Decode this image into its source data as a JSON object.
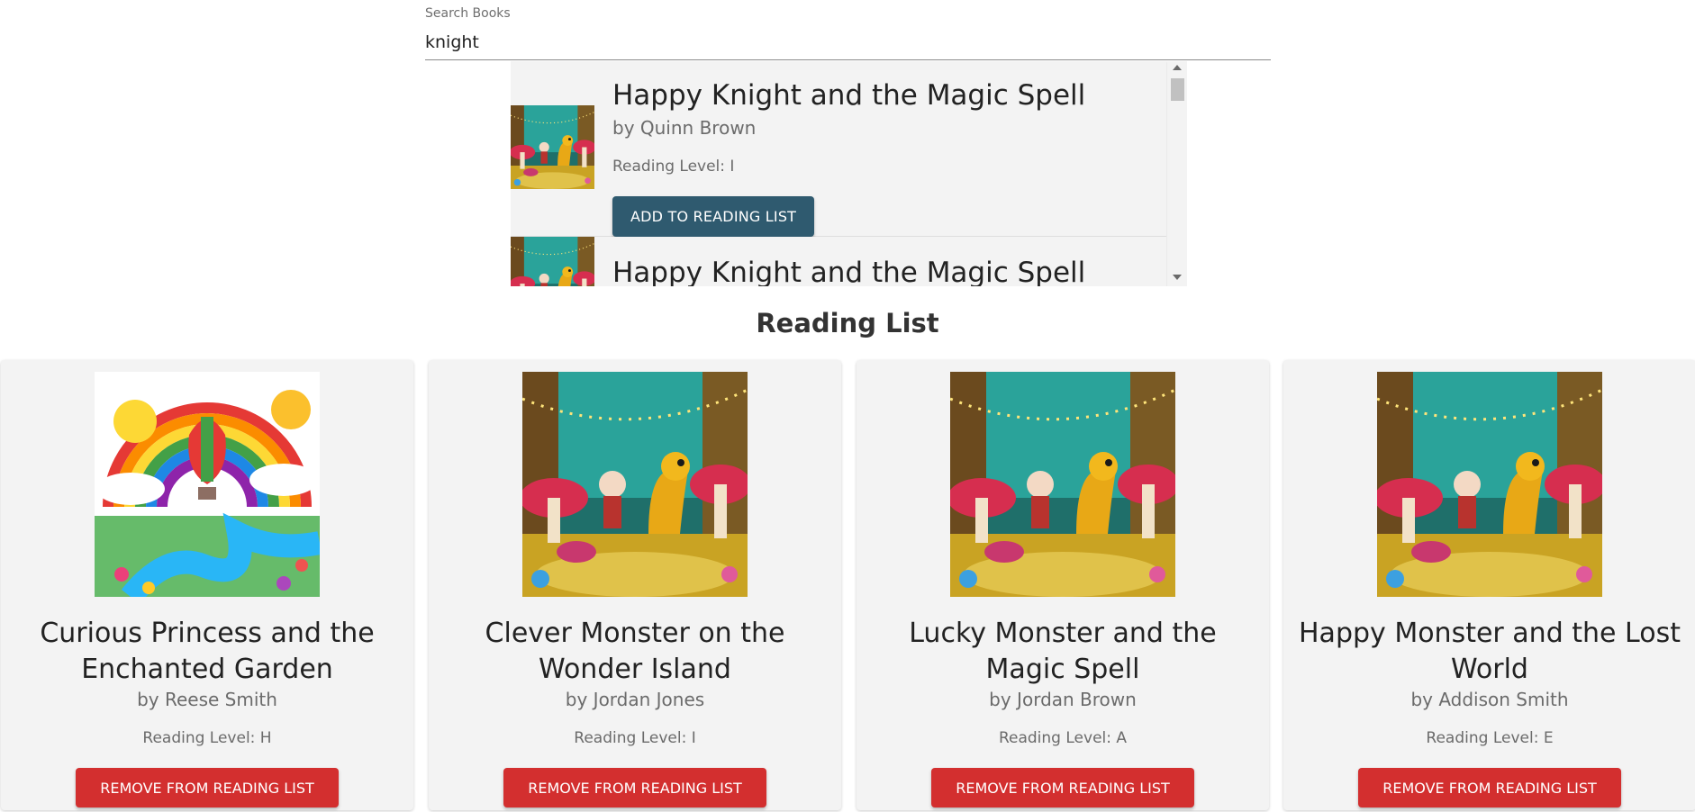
{
  "search": {
    "label": "Search Books",
    "value": "knight"
  },
  "results": [
    {
      "title": "Happy Knight and the Magic Spell",
      "author": "by Quinn Brown",
      "level": "Reading Level: I",
      "add_label": "ADD TO READING LIST",
      "cover": "forest-dragon-cover"
    },
    {
      "title": "Happy Knight and the Magic Spell",
      "author": "",
      "level": "",
      "add_label": "",
      "cover": "forest-dragon-cover"
    }
  ],
  "reading_list": {
    "title": "Reading List",
    "books": [
      {
        "title": "Curious Princess and the Enchanted Garden",
        "author": "by Reese Smith",
        "level": "Reading Level: H",
        "remove_label": "REMOVE FROM READING LIST",
        "cover": "rainbow-balloon-cover"
      },
      {
        "title": "Clever Monster on the Wonder Island",
        "author": "by Jordan Jones",
        "level": "Reading Level: I",
        "remove_label": "REMOVE FROM READING LIST",
        "cover": "forest-dragon-cover"
      },
      {
        "title": "Lucky Monster and the Magic Spell",
        "author": "by Jordan Brown",
        "level": "Reading Level: A",
        "remove_label": "REMOVE FROM READING LIST",
        "cover": "forest-dragon-cover"
      },
      {
        "title": "Happy Monster and the Lost World",
        "author": "by Addison Smith",
        "level": "Reading Level: E",
        "remove_label": "REMOVE FROM READING LIST",
        "cover": "forest-dragon-cover"
      }
    ]
  },
  "colors": {
    "add_button": "#2f5a6f",
    "remove_button": "#d32f2f",
    "card_background": "#f3f3f3"
  }
}
